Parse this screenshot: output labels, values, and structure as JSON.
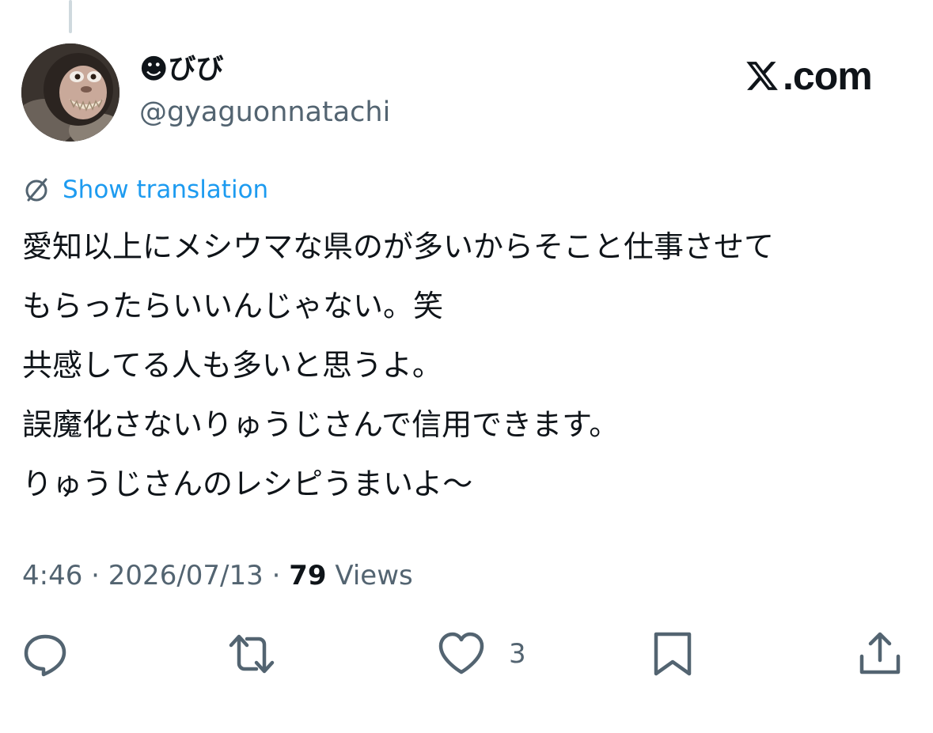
{
  "author": {
    "display_name": "☻びび",
    "handle": "@gyaguonnatachi",
    "avatar_icon": "monkey-avatar"
  },
  "brand": {
    "text": ".com",
    "icon": "x-logo-icon"
  },
  "translation": {
    "label": "Show translation",
    "icon": "translate-icon",
    "color": "#1d9bf0"
  },
  "post": {
    "lines": [
      "愛知以上にメシウマな県のが多いからそこと仕事させて",
      "もらったらいいんじゃない。笑",
      "共感してる人も多いと思うよ。",
      "誤魔化さないりゅうじさんで信用できます。",
      "りゅうじさんのレシピうまいよ〜"
    ]
  },
  "meta": {
    "time": "4:46",
    "separator": "·",
    "date": "2026/07/13",
    "views_count": "79",
    "views_label": "Views"
  },
  "actions": {
    "reply_icon": "reply-icon",
    "retweet_icon": "retweet-icon",
    "like_icon": "heart-icon",
    "like_count": "3",
    "bookmark_icon": "bookmark-icon",
    "share_icon": "share-icon",
    "icon_color": "#536471"
  }
}
